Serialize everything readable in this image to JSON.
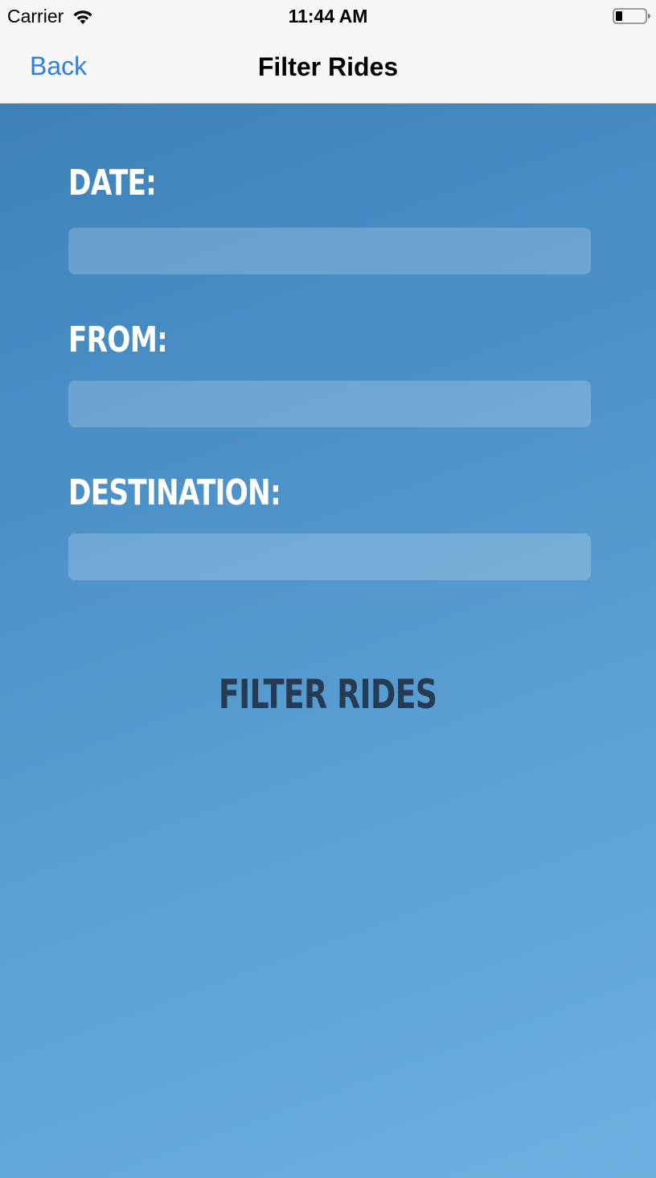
{
  "status_bar": {
    "carrier": "Carrier",
    "time": "11:44 AM",
    "wifi_icon": "wifi-icon",
    "battery_icon": "battery-low-icon"
  },
  "nav": {
    "back_label": "Back",
    "title": "Filter Rides"
  },
  "form": {
    "date_label": "DATE:",
    "date_value": "",
    "from_label": "FROM:",
    "from_value": "",
    "destination_label": "DESTINATION:",
    "destination_value": ""
  },
  "actions": {
    "filter_label": "FILTER RIDES"
  },
  "colors": {
    "accent": "#2f7fde",
    "background_top": "#3a7db5",
    "background_bottom": "#6cb0e0",
    "button_text": "#263a52"
  }
}
